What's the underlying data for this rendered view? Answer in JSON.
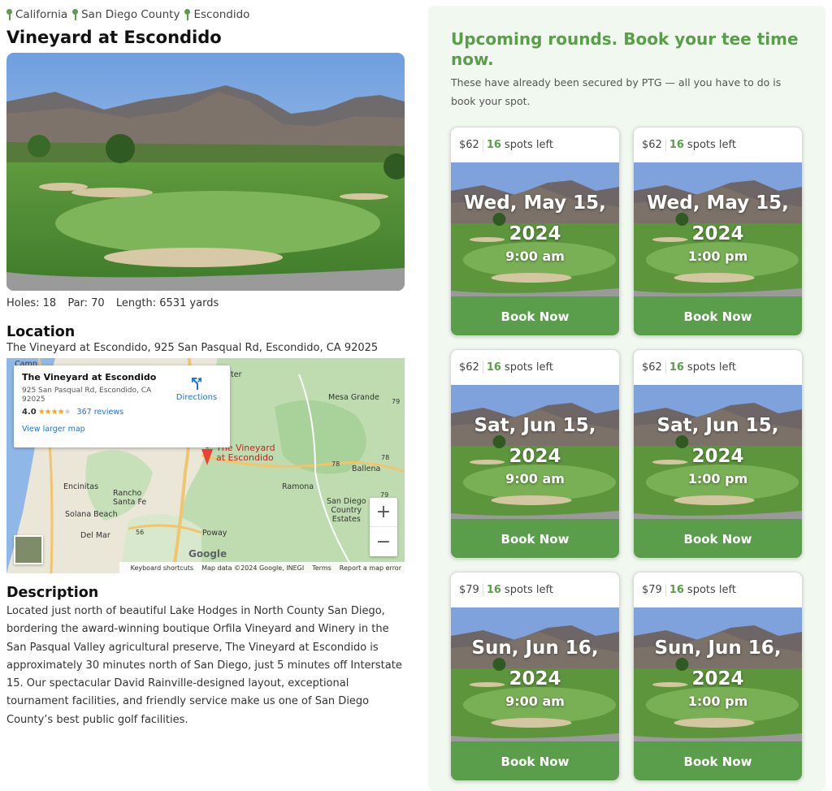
{
  "breadcrumb": [
    {
      "label": "California"
    },
    {
      "label": "San Diego County"
    },
    {
      "label": "Escondido"
    }
  ],
  "course": {
    "title": "Vineyard at Escondido",
    "stats": {
      "holes": "Holes: 18",
      "par": "Par: 70",
      "length": "Length: 6531 yards"
    }
  },
  "location": {
    "heading": "Location",
    "address": "The Vineyard at Escondido, 925 San Pasqual Rd, Escondido, CA 92025"
  },
  "map": {
    "card": {
      "name": "The Vineyard at Escondido",
      "address": "925 San Pasqual Rd, Escondido, CA 92025",
      "rating": "4.0",
      "stars": "★★★★",
      "star_empty": "★",
      "reviews": "367 reviews",
      "larger_map": "View larger map",
      "directions": "Directions"
    },
    "labels": {
      "pin_label_line1": "The Vineyard",
      "pin_label_line2": "at Escondido",
      "mesa_grande": "Mesa Grande",
      "ballena": "Ballena",
      "encinitas": "Encinitas",
      "rancho1": "Rancho",
      "rancho2": "Santa Fe",
      "ramona": "Ramona",
      "sd1": "San Diego",
      "sd2": "Country",
      "sd3": "Estates",
      "solana": "Solana Beach",
      "delmar": "Del Mar",
      "poway": "Poway",
      "camp": "Camp",
      "ter": "ter",
      "r79a": "79",
      "r78a": "78",
      "r78b": "78",
      "r79b": "79",
      "r56": "56"
    },
    "zoom_in": "+",
    "zoom_out": "−",
    "logo": "Google",
    "footer": {
      "shortcuts": "Keyboard shortcuts",
      "data": "Map data ©2024 Google, INEGI",
      "terms": "Terms",
      "report": "Report a map error"
    }
  },
  "description": {
    "heading": "Description",
    "text": "Located just north of beautiful Lake Hodges in North County San Diego, bordering the award-winning boutique Orfila Vineyard and Winery in the San Pasqual Valley agricultural preserve, The Vineyard at Escondido is approximately 30 minutes north of San Diego, just 5 minutes off Interstate 15. Our spectacular David Rainville-designed layout, exceptional tournament facilities, and friendly service make us one of San Diego County’s best public golf facilities."
  },
  "rounds": {
    "title": "Upcoming rounds. Book your tee time now.",
    "subtitle": "These have already been secured by PTG — all you have to do is book your spot.",
    "spots_suffix": "spots left",
    "book_label": "Book Now",
    "cards": [
      {
        "price": "$62",
        "spots": "16",
        "date": "Wed, May 15, 2024",
        "time": "9:00 am"
      },
      {
        "price": "$62",
        "spots": "16",
        "date": "Wed, May 15, 2024",
        "time": "1:00 pm"
      },
      {
        "price": "$62",
        "spots": "16",
        "date": "Sat, Jun 15, 2024",
        "time": "9:00 am"
      },
      {
        "price": "$62",
        "spots": "16",
        "date": "Sat, Jun 15, 2024",
        "time": "1:00 pm"
      },
      {
        "price": "$79",
        "spots": "16",
        "date": "Sun, Jun 16, 2024",
        "time": "9:00 am"
      },
      {
        "price": "$79",
        "spots": "16",
        "date": "Sun, Jun 16, 2024",
        "time": "1:00 pm"
      }
    ]
  },
  "colors": {
    "accent": "#5a9e4b",
    "panel_bg": "#f1f8ef",
    "link": "#1a73e8"
  }
}
